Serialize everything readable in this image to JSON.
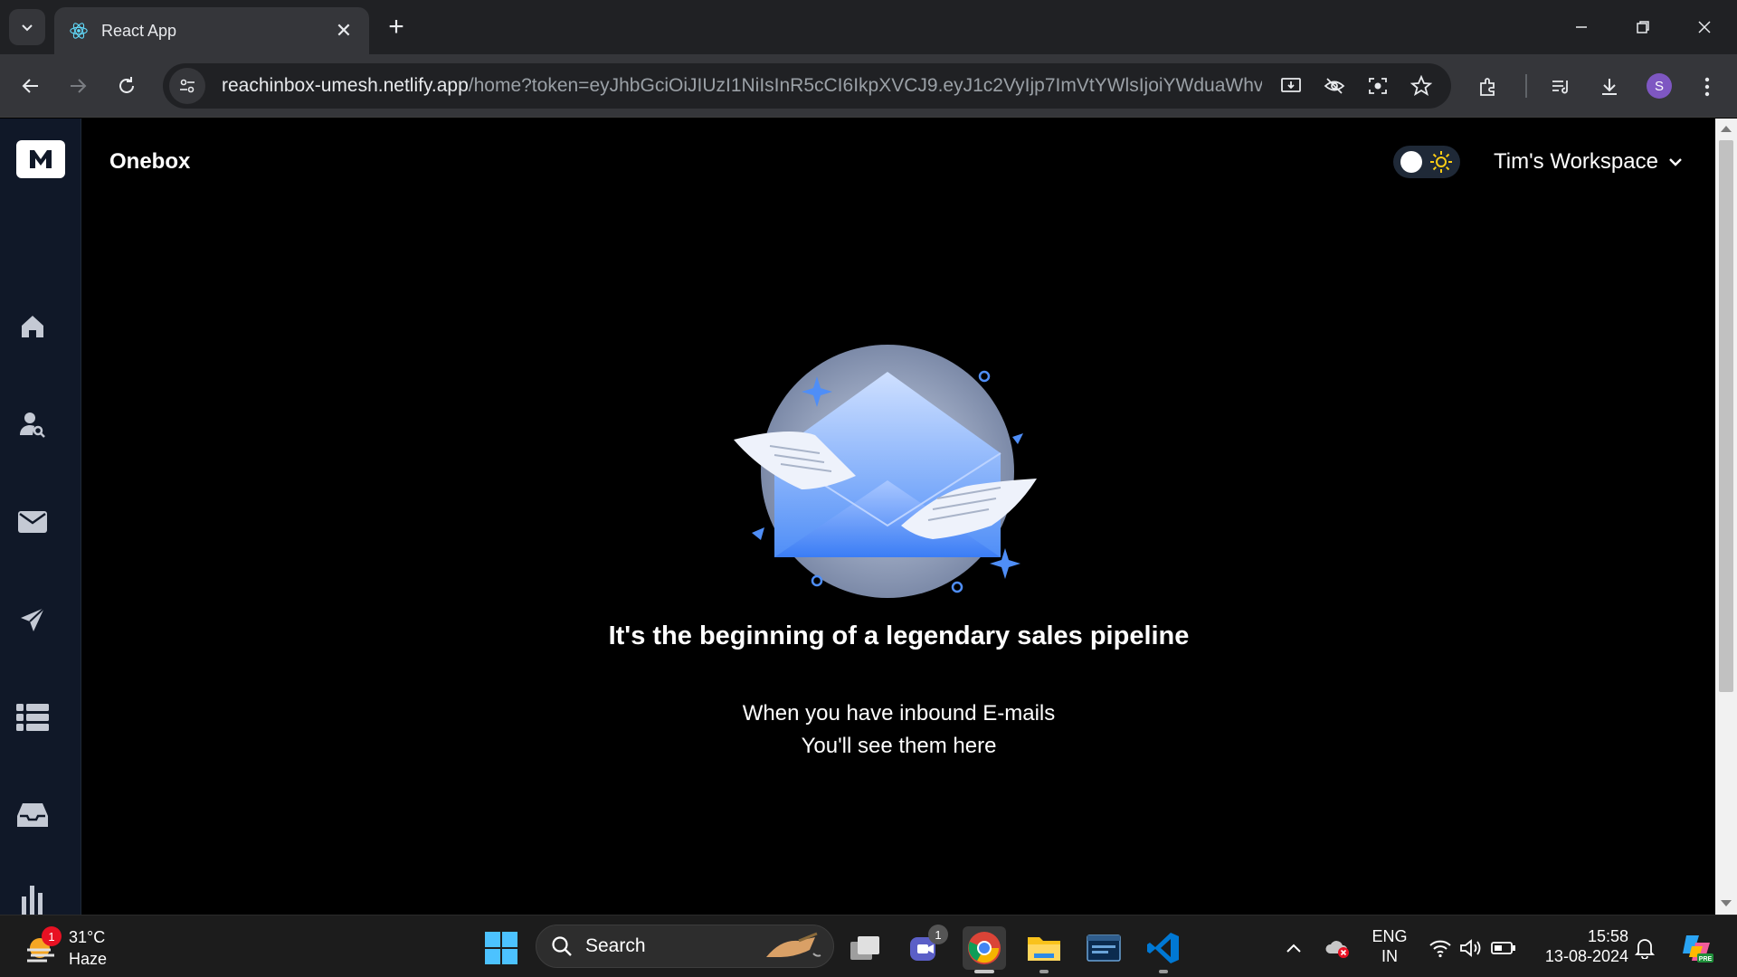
{
  "browser": {
    "tab_title": "React App",
    "url_host": "reachinbox-umesh.netlify.app",
    "url_path": "/home?token=eyJhbGciOiJIUzI1NiIsInR5cCI6IkpXVCJ9.eyJ1c2VyIjp7ImVtYWlsIjoiYWduaWhvd...",
    "profile_initial": "S"
  },
  "app": {
    "title": "Onebox",
    "workspace": "Tim's Workspace",
    "theme": "dark",
    "sidebar_items": [
      "home",
      "user-search",
      "mail",
      "send",
      "list",
      "inbox",
      "analytics"
    ]
  },
  "empty_state": {
    "heading": "It's the beginning of a legendary sales pipeline",
    "line1": "When you have inbound E-mails",
    "line2": "You'll see them here"
  },
  "taskbar": {
    "weather_temp": "31°C",
    "weather_desc": "Haze",
    "weather_badge": "1",
    "search_label": "Search",
    "teams_badge": "1",
    "lang_top": "ENG",
    "lang_bottom": "IN",
    "time": "15:58",
    "date": "13-08-2024"
  },
  "colors": {
    "sidebar_bg": "#101828",
    "accent_blue": "#4f8ef7",
    "profile": "#7e57c2"
  }
}
